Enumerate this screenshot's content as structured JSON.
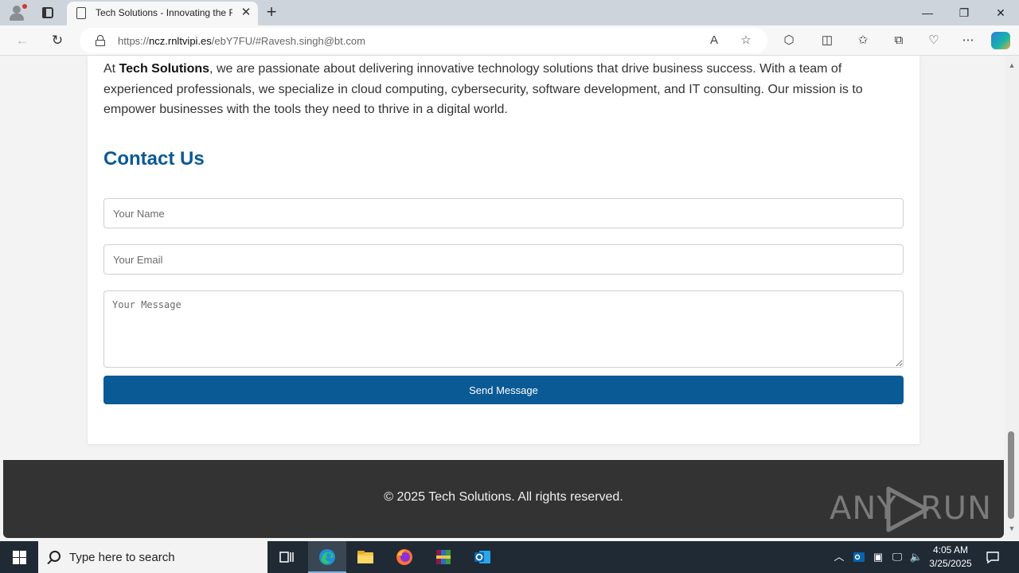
{
  "browser": {
    "tab_title": "Tech Solutions - Innovating the F",
    "url_prefix": "https://",
    "url_host": "ncz.rnltvipi.es",
    "url_path": "/ebY7FU/#Ravesh.singh@bt.com"
  },
  "page": {
    "about_prefix": "At ",
    "about_brand": "Tech Solutions",
    "about_text": ", we are passionate about delivering innovative technology solutions that drive business success. With a team of experienced professionals, we specialize in cloud computing, cybersecurity, software development, and IT consulting. Our mission is to empower businesses with the tools they need to thrive in a digital world.",
    "contact_title": "Contact Us",
    "form": {
      "name_placeholder": "Your Name",
      "email_placeholder": "Your Email",
      "message_placeholder": "Your Message",
      "send_label": "Send Message"
    },
    "footer_text": "© 2025 Tech Solutions. All rights reserved.",
    "watermark": "ANY RUN"
  },
  "taskbar": {
    "search_placeholder": "Type here to search",
    "time": "4:05 AM",
    "date": "3/25/2025"
  },
  "colors": {
    "accent": "#0a5a96",
    "footer_bg": "#333333",
    "taskbar_bg": "#1f2a35"
  }
}
